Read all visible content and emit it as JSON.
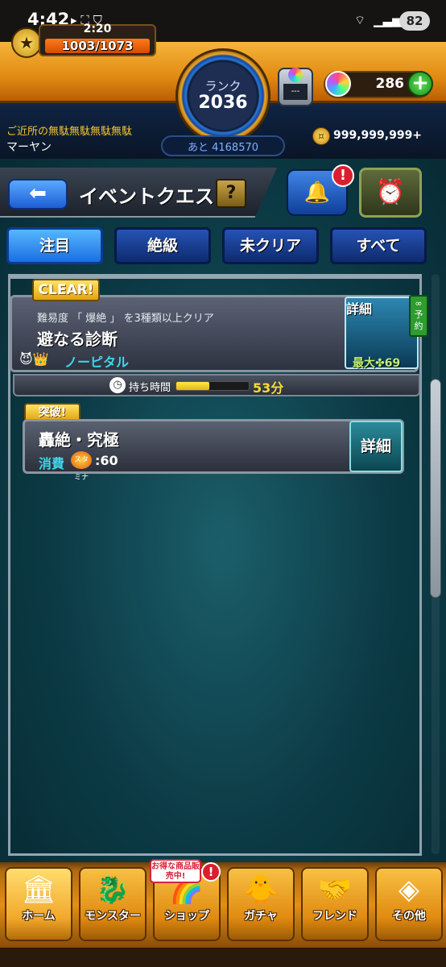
{
  "statusbar": {
    "time": "4:42",
    "battery": "82"
  },
  "header": {
    "stamina_timer": "2:20",
    "stamina": "1003/1073",
    "rank_label": "ランク",
    "rank": "2036",
    "next_rank": "あと 4168570",
    "pc_label": "---",
    "orbs": "286",
    "nearby_label": "ご近所の無駄無駄無駄無駄",
    "username": "マーヤン",
    "coins": "999,999,999+"
  },
  "page": {
    "title": "イベントクエスト",
    "help_label": "?"
  },
  "tabs": [
    {
      "label": "注目",
      "active": true
    },
    {
      "label": "絶級",
      "active": false
    },
    {
      "label": "未クリア",
      "active": false
    },
    {
      "label": "すべて",
      "active": false
    }
  ],
  "quest": {
    "clear_badge": "CLEAR!",
    "condition": "難易度 「 爆絶 」 を3種類以上クリア",
    "title": "避なる診断",
    "tag": "ノーピタル",
    "detail_label": "詳細",
    "max_label": "最大",
    "max_value": "69",
    "book_label": "予約",
    "time_label": "持ち時間",
    "time_value": "53分",
    "time_fraction": 0.45
  },
  "stage": {
    "badge": "突破!",
    "name": "轟絶・究極",
    "cost_label": "消費",
    "stamina_icon_label": "スタミナ",
    "cost_value": ":60",
    "detail_label": "詳細"
  },
  "nav": {
    "items": [
      {
        "label": "ホーム",
        "active": true
      },
      {
        "label": "モンスター",
        "active": false
      },
      {
        "label": "ショップ",
        "active": false
      },
      {
        "label": "ガチャ",
        "active": false
      },
      {
        "label": "フレンド",
        "active": false
      },
      {
        "label": "その他",
        "active": false
      }
    ],
    "promo": "お得な商品販売中!"
  }
}
